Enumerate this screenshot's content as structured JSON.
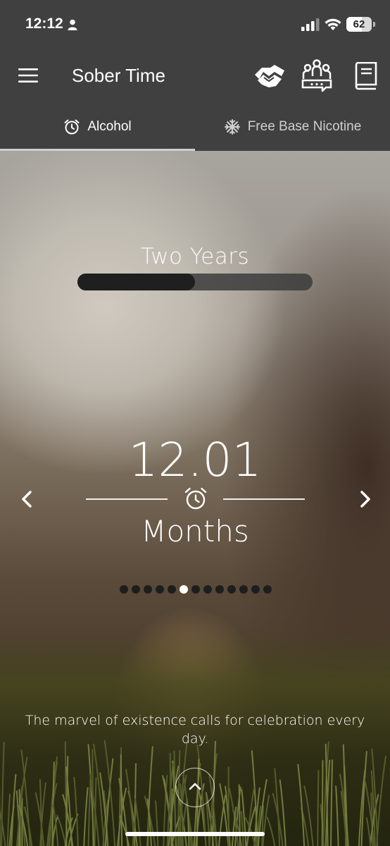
{
  "status_bar": {
    "time": "12:12",
    "battery_level": "62",
    "battery_fraction": 0.62
  },
  "app_bar": {
    "title": "Sober Time",
    "icons": [
      "menu-icon",
      "handshake-icon",
      "group-icon",
      "book-icon"
    ]
  },
  "tabs": [
    {
      "label": "Alcohol",
      "icon": "alarm-clock-icon",
      "active": true
    },
    {
      "label": "Free Base Nicotine",
      "icon": "snowflake-icon",
      "active": false
    }
  ],
  "milestone": {
    "label": "Two Years",
    "progress_fraction": 0.5
  },
  "counter": {
    "value": "12.01",
    "unit": "Months"
  },
  "pager": {
    "total": 13,
    "active_index": 5
  },
  "quote": "The marvel of existence calls for celebration every day.",
  "colors": {
    "bar_background": "#404040",
    "progress_fill": "#1f1f1f",
    "progress_track": "#3c3c3c",
    "dot_active": "#ffffff",
    "dot_inactive": "#1e1e1e"
  }
}
